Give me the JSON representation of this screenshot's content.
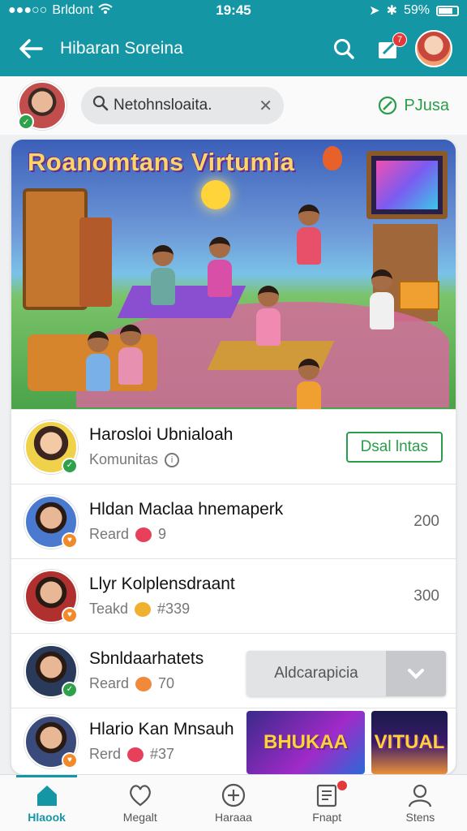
{
  "status_bar": {
    "carrier": "Brldont",
    "time": "19:45",
    "battery": "59%"
  },
  "app_bar": {
    "title": "Hibaran Soreina",
    "notification_count": "7"
  },
  "search": {
    "value": "Netohnsloaita.",
    "action_label": "PJusa"
  },
  "hero": {
    "title": "Roanomtans Virtumia"
  },
  "community": {
    "name": "Harosloi Ubnialoah",
    "subtitle": "Komunitas",
    "button_label": "Dsal lntas"
  },
  "members": [
    {
      "name": "Hldan Maclaa hnemaperk",
      "role": "Reard",
      "count": "9",
      "value": "200"
    },
    {
      "name": "Llyr Kolplensdraant",
      "role": "Teakd",
      "count": "#339",
      "value": "300"
    },
    {
      "name": "Sbnldaarhatets",
      "role": "Reard",
      "count": "70"
    },
    {
      "name": "Hlario Kan Mnsauh",
      "role": "Rerd",
      "count": "#37"
    }
  ],
  "dropdown": {
    "label": "Aldcarapicia"
  },
  "thumbnails": [
    {
      "text": "BHUKAA"
    },
    {
      "text": "VITUAL"
    }
  ],
  "bottom_nav": [
    {
      "label": "Hlaook",
      "active": true
    },
    {
      "label": "Megalt",
      "active": false
    },
    {
      "label": "Haraaa",
      "active": false
    },
    {
      "label": "Fnapt",
      "active": false
    },
    {
      "label": "Stens",
      "active": false
    }
  ],
  "colors": {
    "primary": "#1596a4",
    "accent_green": "#2a9d4a",
    "badge_red": "#e23a3a"
  }
}
